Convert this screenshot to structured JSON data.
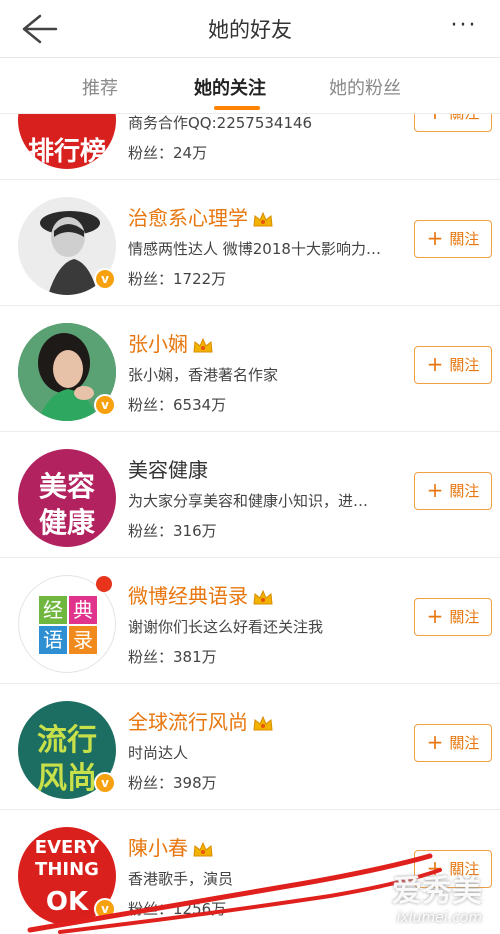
{
  "header": {
    "title": "她的好友",
    "more": "···"
  },
  "tabs": [
    {
      "label": "推荐"
    },
    {
      "label": "她的关注"
    },
    {
      "label": "她的粉丝"
    }
  ],
  "colors": {
    "accent": "#ff8200",
    "name_vip": "#e8760e",
    "badge": "#f7a10f"
  },
  "follow_label": "關注",
  "rows": [
    {
      "name": "",
      "avatar_text": "排行榜",
      "desc": "商务合作QQ:2257534146",
      "fans": "粉丝：24万"
    },
    {
      "name": "治愈系心理学",
      "desc": "情感两性达人 微博2018十大影响力…",
      "fans": "粉丝：1722万"
    },
    {
      "name": "张小娴",
      "desc": "张小娴，香港著名作家",
      "fans": "粉丝：6534万"
    },
    {
      "name": "美容健康",
      "avatar_text_1": "美容",
      "avatar_text_2": "健康",
      "desc": "为大家分享美容和健康小知识，进…",
      "fans": "粉丝：316万"
    },
    {
      "name": "微博经典语录",
      "avatar_text": [
        "经",
        "典",
        "语",
        "录"
      ],
      "desc": "谢谢你们长这么好看还关注我",
      "fans": "粉丝：381万"
    },
    {
      "name": "全球流行风尚",
      "avatar_text_1": "流行",
      "avatar_text_2": "风尚",
      "desc": "时尚达人",
      "fans": "粉丝：398万"
    },
    {
      "name": "陳小春",
      "avatar_text_1": "EVERY",
      "avatar_text_2": "THING",
      "avatar_text_3": "OK",
      "desc": "香港歌手，演员",
      "fans": "粉丝：1256万"
    }
  ],
  "watermark": {
    "cn": "爱秀美",
    "en": "ixiumei.com"
  }
}
